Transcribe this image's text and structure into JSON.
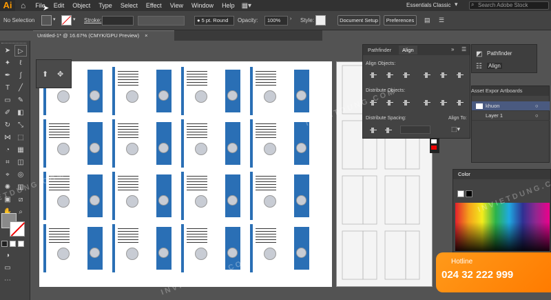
{
  "app": {
    "logo": "Ai",
    "home_icon": "home-icon"
  },
  "menu": [
    "File",
    "Edit",
    "Object",
    "Type",
    "Select",
    "Effect",
    "View",
    "Window",
    "Help"
  ],
  "workspace": "Essentials Classic",
  "search_placeholder": "Search Adobe Stock",
  "control_bar": {
    "selection": "No Selection",
    "stroke_label": "Stroke:",
    "brush": "5 pt. Round",
    "opacity_label": "Opacity:",
    "opacity_value": "100%",
    "style_label": "Style:",
    "document_setup": "Document Setup",
    "preferences": "Preferences"
  },
  "document_tab": {
    "title": "Untitled-1* @ 16.67% (CMYK/GPU Preview)"
  },
  "align_panel": {
    "tabs": [
      "Pathfinder",
      "Align"
    ],
    "align_objects": "Align Objects:",
    "distribute_objects": "Distribute Objects:",
    "distribute_spacing": "Distribute Spacing:",
    "align_to": "Align To:"
  },
  "mini_panel": {
    "items": [
      "Pathfinder",
      "Align"
    ]
  },
  "layers_panel": {
    "tabs": [
      "Asset Expor",
      "Artboards"
    ],
    "layers": [
      "khuon",
      "Layer 1"
    ]
  },
  "color_panel": {
    "title": "Color"
  },
  "watermark": "INVIETDUNG.COM",
  "hotline": {
    "label": "Hotline",
    "number": "024 32 222 999"
  },
  "colors": {
    "accent": "#ff9a00",
    "blue": "#2a6fb5",
    "hotline_bg": "#ff8a00"
  }
}
